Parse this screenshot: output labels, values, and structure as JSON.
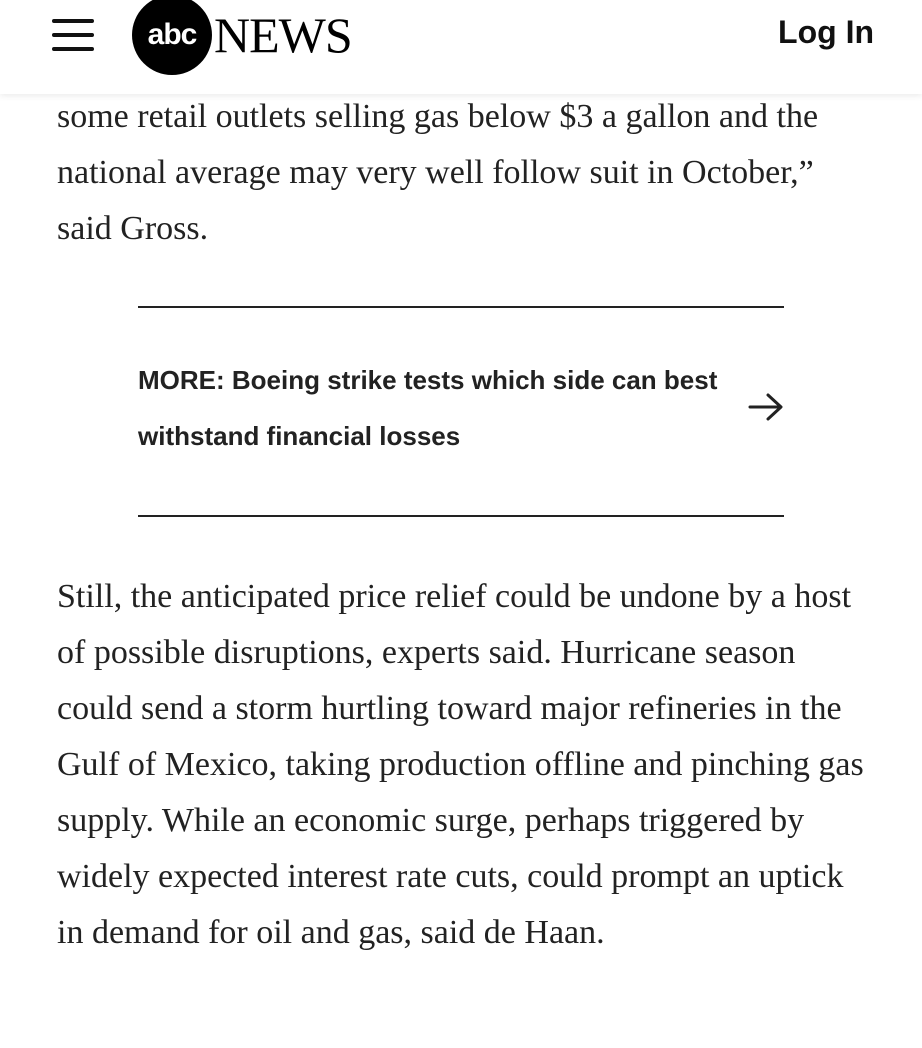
{
  "header": {
    "logo_mark": "abc",
    "logo_word": "NEWS",
    "login_label": "Log In"
  },
  "article": {
    "paragraph_1": "some retail outlets selling gas below $3 a gallon and the national average may very well follow suit in October,” said Gross.",
    "more_link": "MORE: Boeing strike tests which side can best withstand financial losses",
    "paragraph_2": "Still, the anticipated price relief could be undone by a host of possible disruptions, experts said. Hurricane season could send a storm hurtling toward major refineries in the Gulf of Mexico, taking production offline and pinching gas supply. While an economic surge, perhaps triggered by widely expected interest rate cuts, could prompt an uptick in demand for oil and gas, said de Haan."
  },
  "icons": {
    "menu": "hamburger-menu-icon",
    "arrow": "arrow-right-icon"
  }
}
